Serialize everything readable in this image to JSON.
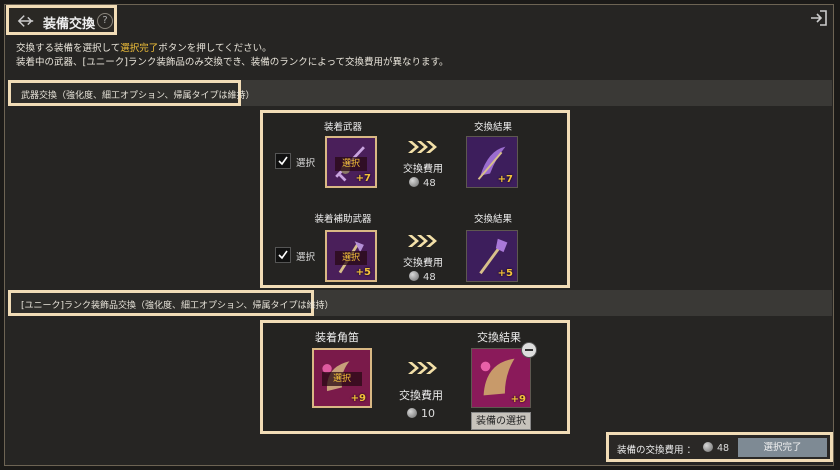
{
  "header": {
    "title": "装備交換",
    "help": "?"
  },
  "info": {
    "line1_prefix": "交換する装備を選択して",
    "line1_em": "選択完了",
    "line1_suffix": "ボタンを押してください。",
    "line2": "装着中の武器、[ユニーク]ランク装飾品のみ交換でき、装備のランクによって交換費用が異なります。"
  },
  "weapon_section": {
    "label": "武器交換（強化度、細工オプション、帰属タイプは維持）",
    "rows": [
      {
        "src_label": "装着武器",
        "result_label": "交換結果",
        "check_label": "選択",
        "selected_badge": "選択",
        "src_plus": "+7",
        "cost_label": "交換費用",
        "cost": "48",
        "result_plus": "+7"
      },
      {
        "src_label": "装着補助武器",
        "result_label": "交換結果",
        "check_label": "選択",
        "selected_badge": "選択",
        "src_plus": "+5",
        "cost_label": "交換費用",
        "cost": "48",
        "result_plus": "+5"
      }
    ]
  },
  "accessory_section": {
    "label": "[ユニーク]ランク装飾品交換（強化度、細工オプション、帰属タイプは維持）",
    "src_label": "装着角笛",
    "result_label": "交換結果",
    "selected_badge": "選択",
    "src_plus": "+9",
    "cost_label": "交換費用",
    "cost": "10",
    "result_plus": "+9",
    "choose_button": "装備の選択"
  },
  "footer": {
    "cost_label": "装備の交換費用 ：",
    "cost": "48",
    "done_button": "選択完了"
  },
  "colors": {
    "accent": "#f4c23a",
    "highlight": "#f1dcb6",
    "done_button": "#7e8a94"
  }
}
